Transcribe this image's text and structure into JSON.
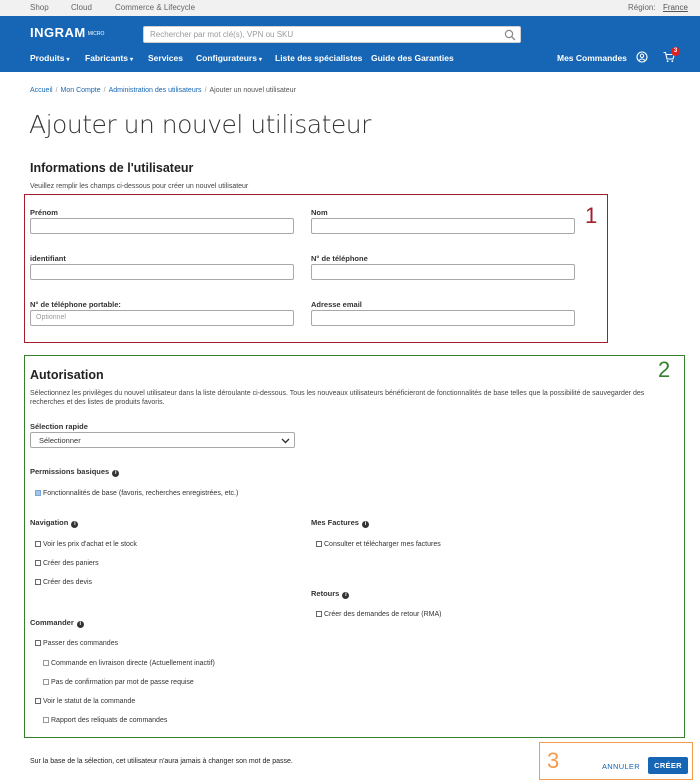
{
  "topbar": {
    "links": [
      "Shop",
      "Cloud",
      "Commerce & Lifecycle"
    ],
    "region_label": "Région:",
    "region_value": "France"
  },
  "navbar": {
    "logo": "INGRAM",
    "logo_sub": "MICRO",
    "search_placeholder": "Rechercher par mot clé(s), VPN ou SKU",
    "menu": [
      "Produits",
      "Fabricants",
      "Services",
      "Configurateurs",
      "Liste des spécialistes",
      "Guide des Garanties"
    ],
    "orders": "Mes Commandes",
    "cart_count": "3"
  },
  "breadcrumb": [
    "Accueil",
    "Mon Compte",
    "Administration des utilisateurs",
    "Ajouter un nouvel utilisateur"
  ],
  "page_title": "Ajouter un nouvel utilisateur",
  "user_info": {
    "title": "Informations de l'utilisateur",
    "hint": "Veuillez remplir les champs ci-dessous pour créer un nouvel utilisateur",
    "fields": {
      "first_name": {
        "label": "Prénom",
        "value": ""
      },
      "last_name": {
        "label": "Nom",
        "value": ""
      },
      "login": {
        "label": "identifiant",
        "value": ""
      },
      "phone": {
        "label": "N° de téléphone",
        "value": ""
      },
      "mobile": {
        "label": "N° de téléphone portable:",
        "placeholder": "Optionnel",
        "value": ""
      },
      "email": {
        "label": "Adresse email",
        "value": ""
      }
    }
  },
  "authorization": {
    "title": "Autorisation",
    "description": "Sélectionnez les privilèges du nouvel utilisateur dans la liste déroulante ci-dessous. Tous les nouveaux utilisateurs bénéficieront de fonctionnalités de base telles que la possibilité de sauvegarder des recherches et des listes de produits favoris.",
    "quick_select_label": "Sélection rapide",
    "quick_select_value": "Sélectionner",
    "basic": {
      "title": "Permissions basiques",
      "items": [
        {
          "label": "Fonctionnalités de base (favoris, recherches enregistrées, etc.)",
          "checked": true
        }
      ]
    },
    "navigation": {
      "title": "Navigation",
      "items": [
        {
          "label": "Voir les prix d'achat et le stock",
          "checked": false
        },
        {
          "label": "Créer des paniers",
          "checked": false
        },
        {
          "label": "Créer des devis",
          "checked": false
        }
      ]
    },
    "invoices": {
      "title": "Mes Factures",
      "items": [
        {
          "label": "Consulter et télécharger mes factures",
          "checked": false
        }
      ]
    },
    "returns": {
      "title": "Retours",
      "items": [
        {
          "label": "Créer des demandes de retour (RMA)",
          "checked": false
        }
      ]
    },
    "ordering": {
      "title": "Commander",
      "items": [
        {
          "label": "Passer des commandes",
          "checked": false
        },
        {
          "label": "Commande en livraison directe (Actuellement inactif)",
          "checked": false
        },
        {
          "label": "Pas de confirmation par mot de passe requise",
          "checked": false
        },
        {
          "label": "Voir le statut de la commande",
          "checked": false
        },
        {
          "label": "Rapport des reliquats de commandes",
          "checked": false
        }
      ]
    }
  },
  "footer": {
    "note": "Sur la base de la sélection, cet utilisateur n'aura jamais à changer son mot de passe.",
    "cancel": "ANNULER",
    "create": "CRÉER"
  },
  "annotations": {
    "one": "1",
    "two": "2",
    "three": "3"
  },
  "colors": {
    "brand": "#1666b5",
    "box1": "#a31d2a",
    "box2": "#35812b",
    "box3": "#f39a4c"
  }
}
